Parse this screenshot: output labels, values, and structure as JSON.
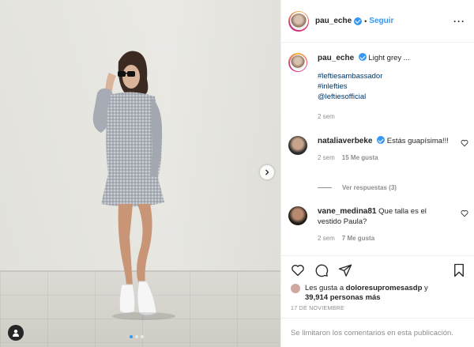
{
  "post": {
    "author": "pau_eche",
    "follow_separator": "•",
    "follow_label": "Seguir",
    "more_label": "···"
  },
  "carousel": {
    "slides_total": 3,
    "active_index": 0
  },
  "caption": {
    "username": "pau_eche",
    "text": "Light grey ...",
    "tags": [
      "#leftiesambassador",
      "#inlefties",
      "@leftiesofficial"
    ],
    "time": "2 sem"
  },
  "comments": [
    {
      "username": "nataliaverbeke",
      "text": "Estás guapísima!!!",
      "time": "2 sem",
      "likes": "15 Me gusta",
      "replies": "Ver respuestas (3)"
    },
    {
      "username": "vane_medina81",
      "text": "Que talla es el vestido Paula?",
      "time": "2 sem",
      "likes": "7 Me gusta"
    }
  ],
  "likes": {
    "prefix": "Les gusta a ",
    "user": "doloresupromesasdp",
    "connector": " y",
    "count": "39,914 personas más"
  },
  "date": "17 DE NOVIEMBRE",
  "footer": "Se limitaron los comentarios en esta publicación.",
  "colors": {
    "link": "#3897f0",
    "tag": "#00376b",
    "muted": "#8e8e8e"
  }
}
